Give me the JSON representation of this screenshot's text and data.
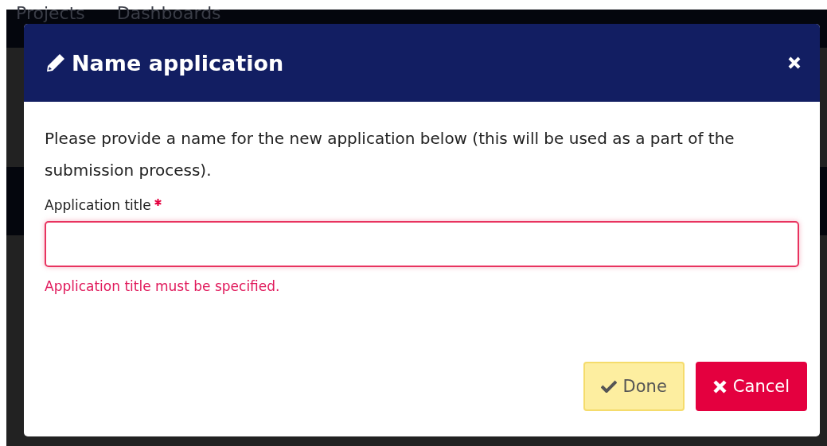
{
  "nav": [
    {
      "label": "Projects"
    },
    {
      "label": "Dashboards"
    }
  ],
  "dialog": {
    "title": "Name application",
    "message": "Please provide a name for the new application below (this will be used as a part of the submission process).",
    "field": {
      "label": "Application title",
      "required": true,
      "invalid": true,
      "error": "Application title must be specified."
    },
    "buttons": [
      {
        "label": "Done",
        "kind": "confirm"
      },
      {
        "label": "Cancel",
        "kind": "cancel"
      }
    ]
  }
}
